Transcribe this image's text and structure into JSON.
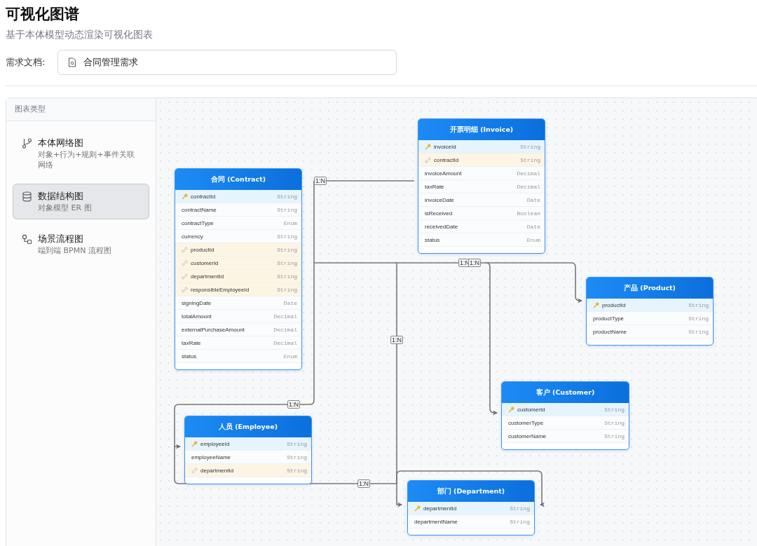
{
  "page": {
    "title": "可视化图谱",
    "subtitle": "基于本体模型动态渲染可视化图表"
  },
  "document": {
    "label": "需求文档:",
    "value": "合同管理需求"
  },
  "sidebar": {
    "title": "图表类型",
    "items": [
      {
        "title": "本体网络图",
        "description": "对象+行为+规则+事件关联网络",
        "selected": false
      },
      {
        "title": "数据结构图",
        "description": "对象模型 ER 图",
        "selected": true
      },
      {
        "title": "场景流程图",
        "description": "端到端 BPMN 流程图",
        "selected": false
      }
    ]
  },
  "diagram": {
    "entities": [
      {
        "title": "合同 (Contract)",
        "fields": [
          {
            "name": "contractId",
            "type": "String",
            "kind": "pk"
          },
          {
            "name": "contractName",
            "type": "String",
            "kind": "plain"
          },
          {
            "name": "contractType",
            "type": "Enum",
            "kind": "plain"
          },
          {
            "name": "currency",
            "type": "String",
            "kind": "plain"
          },
          {
            "name": "productId",
            "type": "String",
            "kind": "fk"
          },
          {
            "name": "customerId",
            "type": "String",
            "kind": "fk"
          },
          {
            "name": "departmentId",
            "type": "String",
            "kind": "fk"
          },
          {
            "name": "responsibleEmployeeId",
            "type": "String",
            "kind": "fk"
          },
          {
            "name": "signingDate",
            "type": "Date",
            "kind": "plain"
          },
          {
            "name": "totalAmount",
            "type": "Decimal",
            "kind": "plain"
          },
          {
            "name": "externalPurchaseAmount",
            "type": "Decimal",
            "kind": "plain"
          },
          {
            "name": "taxRate",
            "type": "Decimal",
            "kind": "plain"
          },
          {
            "name": "status",
            "type": "Enum",
            "kind": "plain"
          }
        ]
      },
      {
        "title": "开票明细 (Invoice)",
        "fields": [
          {
            "name": "invoiceId",
            "type": "String",
            "kind": "pk"
          },
          {
            "name": "contractId",
            "type": "String",
            "kind": "fk"
          },
          {
            "name": "invoiceAmount",
            "type": "Decimal",
            "kind": "plain"
          },
          {
            "name": "taxRate",
            "type": "Decimal",
            "kind": "plain"
          },
          {
            "name": "invoiceDate",
            "type": "Date",
            "kind": "plain"
          },
          {
            "name": "isReceived",
            "type": "Boolean",
            "kind": "plain"
          },
          {
            "name": "receivedDate",
            "type": "Date",
            "kind": "plain"
          },
          {
            "name": "status",
            "type": "Enum",
            "kind": "plain"
          }
        ]
      },
      {
        "title": "产品 (Product)",
        "fields": [
          {
            "name": "productId",
            "type": "String",
            "kind": "pk"
          },
          {
            "name": "productType",
            "type": "String",
            "kind": "plain"
          },
          {
            "name": "productName",
            "type": "String",
            "kind": "plain"
          }
        ]
      },
      {
        "title": "客户 (Customer)",
        "fields": [
          {
            "name": "customerId",
            "type": "String",
            "kind": "pk"
          },
          {
            "name": "customerType",
            "type": "String",
            "kind": "plain"
          },
          {
            "name": "customerName",
            "type": "String",
            "kind": "plain"
          }
        ]
      },
      {
        "title": "人员 (Employee)",
        "fields": [
          {
            "name": "employeeId",
            "type": "String",
            "kind": "pk"
          },
          {
            "name": "employeeName",
            "type": "String",
            "kind": "plain"
          },
          {
            "name": "departmentId",
            "type": "String",
            "kind": "fk"
          }
        ]
      },
      {
        "title": "部门 (Department)",
        "fields": [
          {
            "name": "departmentId",
            "type": "String",
            "kind": "pk"
          },
          {
            "name": "departmentName",
            "type": "String",
            "kind": "plain"
          }
        ]
      }
    ],
    "relations": [
      {
        "label": "1:N"
      },
      {
        "label": "1:N"
      },
      {
        "label": "1:N"
      },
      {
        "label": "1:N"
      },
      {
        "label": "1:N"
      },
      {
        "label": "1:N"
      }
    ]
  }
}
